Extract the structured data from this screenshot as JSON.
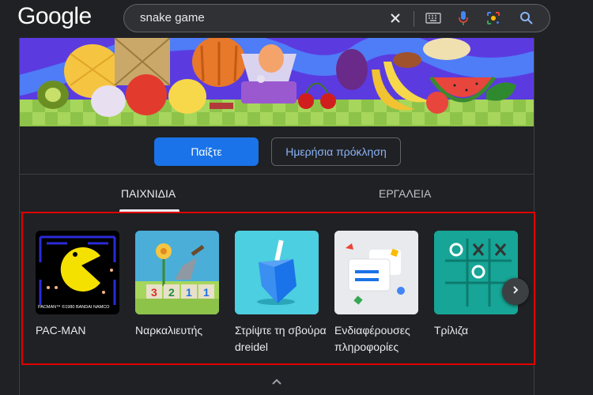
{
  "header": {
    "logo": "Google",
    "search_query": "snake game"
  },
  "actions": {
    "play_label": "Παίξτε",
    "daily_label": "Ημερήσια πρόκληση"
  },
  "tabs": [
    {
      "label": "ΠΑΙΧΝΙΔΙΑ",
      "active": true
    },
    {
      "label": "ΕΡΓΑΛΕΙΑ",
      "active": false
    }
  ],
  "games": [
    {
      "label": "PAC-MAN",
      "thumb_caption": "PACMAN™ ©1980 BANDAI NAMCO"
    },
    {
      "label": "Ναρκαλιευτής",
      "tiles": [
        "3",
        "2",
        "1",
        "1"
      ]
    },
    {
      "label": "Στρίψτε τη σβούρα dreidel"
    },
    {
      "label": "Ενδιαφέρουσες πληροφορίες"
    },
    {
      "label": "Τρίλιζα"
    }
  ],
  "colors": {
    "background": "#202124",
    "primary_button": "#1a73e8",
    "link_blue": "#8ab4f8",
    "highlight_border": "#e00000"
  },
  "icons": [
    "clear-icon",
    "keyboard-icon",
    "microphone-icon",
    "lens-icon",
    "search-icon",
    "chevron-right-icon",
    "chevron-up-icon"
  ]
}
